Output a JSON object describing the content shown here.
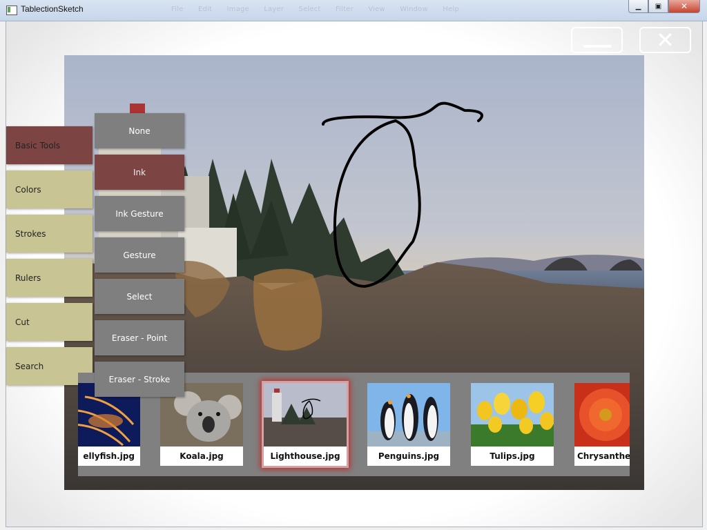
{
  "window": {
    "title": "TablectionSketch",
    "ghost_menu": [
      "File",
      "Edit",
      "Image",
      "Layer",
      "Select",
      "Filter",
      "View",
      "Window",
      "Help"
    ],
    "controls": {
      "minimize": "▁",
      "restore": "▣",
      "close": "✕"
    }
  },
  "overlay": {
    "minimize_icon": "minimize-icon",
    "close_glyph": "✕"
  },
  "main_menu": {
    "items": [
      {
        "label": "Basic Tools",
        "selected": true
      },
      {
        "label": "Colors",
        "selected": false
      },
      {
        "label": "Strokes",
        "selected": false
      },
      {
        "label": "Rulers",
        "selected": false
      },
      {
        "label": "Cut",
        "selected": false
      },
      {
        "label": "Search",
        "selected": false
      }
    ]
  },
  "tool_menu": {
    "items": [
      {
        "label": "None",
        "selected": false
      },
      {
        "label": "Ink",
        "selected": true
      },
      {
        "label": "Ink Gesture",
        "selected": false
      },
      {
        "label": "Gesture",
        "selected": false
      },
      {
        "label": "Select",
        "selected": false
      },
      {
        "label": "Eraser - Point",
        "selected": false
      },
      {
        "label": "Eraser - Stroke",
        "selected": false
      }
    ]
  },
  "thumbnails": [
    {
      "caption": "ellyfish.jpg",
      "selected": false
    },
    {
      "caption": "Koala.jpg",
      "selected": false
    },
    {
      "caption": "Lighthouse.jpg",
      "selected": true
    },
    {
      "caption": "Penguins.jpg",
      "selected": false
    },
    {
      "caption": "Tulips.jpg",
      "selected": false
    },
    {
      "caption": "Chrysanthem",
      "selected": false
    }
  ],
  "colors": {
    "selected_menu": "#7d4444",
    "menu": "#c8c494",
    "submenu": "#7f7f7f",
    "strip": "#808080",
    "ink": "#000000"
  }
}
